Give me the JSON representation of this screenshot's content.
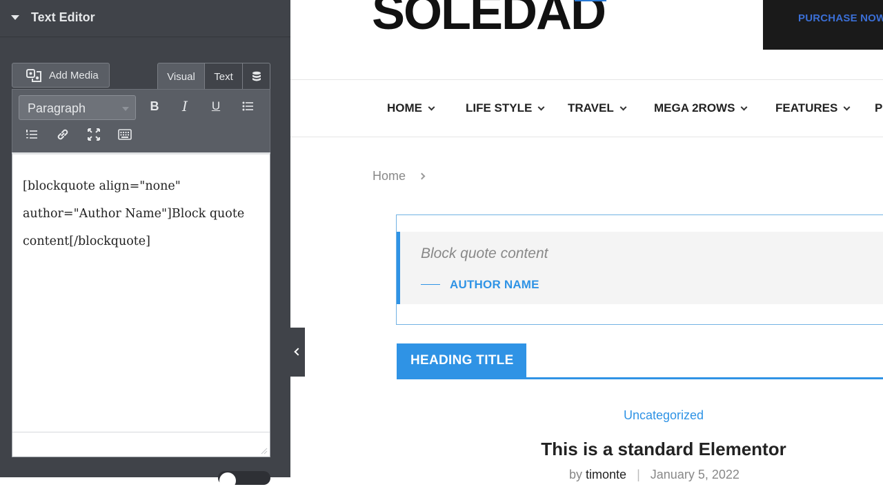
{
  "editor_panel": {
    "title": "Text Editor",
    "add_media_label": "Add Media",
    "tabs": {
      "visual": "Visual",
      "text": "Text"
    },
    "format_select": "Paragraph",
    "content_lines": [
      "[blockquote align=\"none\"",
      "author=\"Author Name\"]Block quote",
      "content[/blockquote]"
    ]
  },
  "site": {
    "logo": "SOLEDAD",
    "purchase_label": "PURCHASE NOW",
    "nav": [
      "HOME",
      "LIFE STYLE",
      "TRAVEL",
      "MEGA 2ROWS",
      "FEATURES",
      "P"
    ],
    "breadcrumb_home": "Home",
    "blockquote": {
      "text": "Block quote content",
      "author": "AUTHOR NAME"
    },
    "heading_title": "HEADING TITLE",
    "post": {
      "category": "Uncategorized",
      "title": "This is a standard Elementor",
      "by": "by",
      "author": "timonte",
      "date": "January 5, 2022"
    }
  },
  "colors": {
    "accent": "#2f93e5",
    "panel_bg": "#404349",
    "toolbar_bg": "#5a5e65"
  }
}
